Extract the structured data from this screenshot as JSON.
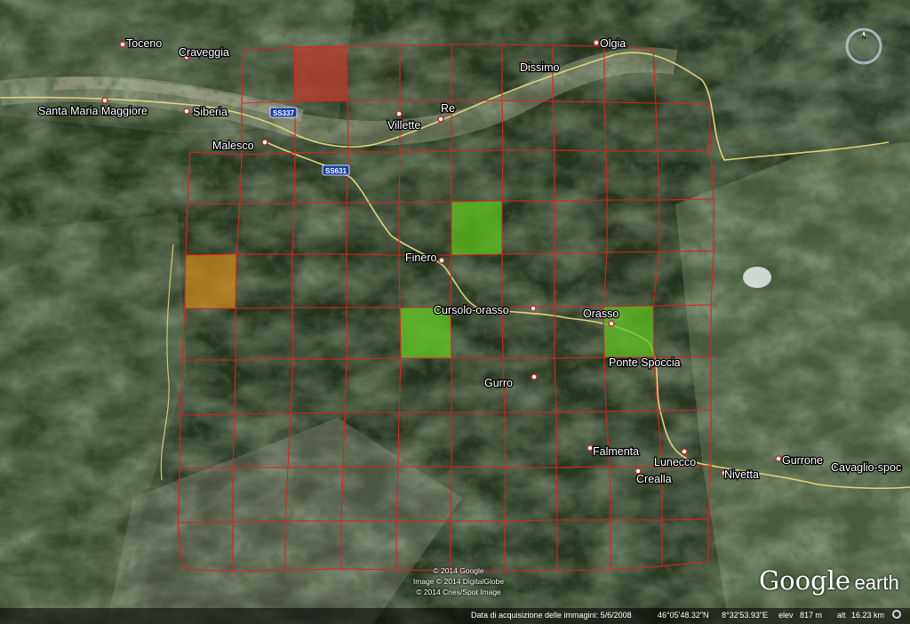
{
  "map": {
    "places": [
      {
        "id": "toceno",
        "name": "Toceno"
      },
      {
        "id": "craveggia",
        "name": "Craveggia"
      },
      {
        "id": "santa-maria-maggiore",
        "name": "Santa Maria Maggiore"
      },
      {
        "id": "siberia",
        "name": "Siberia"
      },
      {
        "id": "malesco",
        "name": "Malesco"
      },
      {
        "id": "villette",
        "name": "Villette"
      },
      {
        "id": "re",
        "name": "Re"
      },
      {
        "id": "dissimo",
        "name": "Dissimo"
      },
      {
        "id": "olgia",
        "name": "Olgia"
      },
      {
        "id": "finero",
        "name": "Finero"
      },
      {
        "id": "cursolo-orasso",
        "name": "Cursolo-orasso"
      },
      {
        "id": "orasso",
        "name": "Orasso"
      },
      {
        "id": "ponte-spoccia",
        "name": "Ponte Spoccia"
      },
      {
        "id": "gurro",
        "name": "Gurro"
      },
      {
        "id": "falmenta",
        "name": "Falmenta"
      },
      {
        "id": "lunecco",
        "name": "Lunecco"
      },
      {
        "id": "crealla",
        "name": "Crealla"
      },
      {
        "id": "nivetta",
        "name": "Nivetta"
      },
      {
        "id": "gurrone",
        "name": "Gurrone"
      },
      {
        "id": "cavaglio-spoccia",
        "name": "Cavaglio-spoc"
      }
    ],
    "road_shields": [
      "SS337",
      "SS631"
    ],
    "grid": {
      "line_color": "#e02020",
      "highlighted_cells": [
        {
          "name": "cell-red",
          "color": "#c0392b"
        },
        {
          "name": "cell-orange",
          "color": "#c8871a"
        },
        {
          "name": "cell-green-1",
          "color": "#5ec41f"
        },
        {
          "name": "cell-green-2",
          "color": "#5ec41f"
        },
        {
          "name": "cell-green-3",
          "color": "#5ec41f"
        }
      ]
    }
  },
  "compass": {
    "north_label": "N"
  },
  "credits": {
    "line1": "© 2014 Google",
    "line2": "Image © 2014 DigitalGlobe",
    "line3": "© 2014 Cnes/Spot Image"
  },
  "logo": {
    "part1": "Google",
    "part2": "earth"
  },
  "status": {
    "acquisition": "Data di acquisizione delle immagini: 5/6/2008",
    "lat": "46°05'48.32\"N",
    "lon": "8°32'53.93\"E",
    "elev_label": "elev",
    "elev": "817 m",
    "alt_label": "alt",
    "alt": "16.23 km"
  }
}
